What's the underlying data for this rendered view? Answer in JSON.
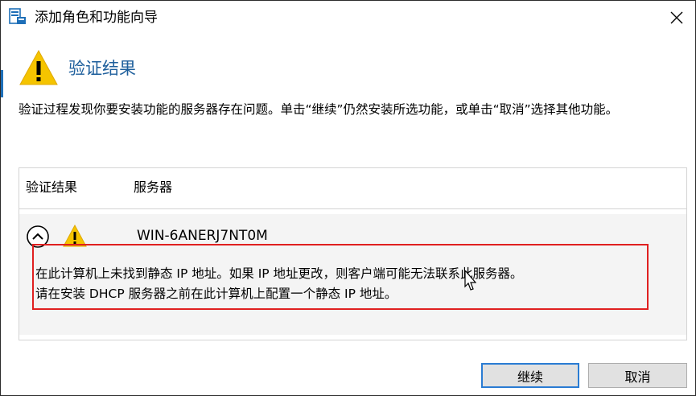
{
  "window": {
    "title": "添加角色和功能向导"
  },
  "dialog": {
    "heading": "验证结果",
    "description": "验证过程发现你要安装功能的服务器存在问题。单击“继续”仍然安装所选功能，或单击“取消”选择其他功能。"
  },
  "table": {
    "columns": [
      "验证结果",
      "服务器"
    ],
    "rows": [
      {
        "server": "WIN-6ANERJ7NT0M",
        "detail_line1": "在此计算机上未找到静态 IP 地址。如果 IP 地址更改，则客户端可能无法联系此服务器。",
        "detail_line2": "请在安装 DHCP 服务器之前在此计算机上配置一个静态 IP 地址。"
      }
    ]
  },
  "buttons": {
    "continue": "继续",
    "cancel": "取消"
  },
  "colors": {
    "heading": "#1e5f9c",
    "warning": "#f5c400",
    "highlight": "#e02020",
    "focus": "#2a7cd3"
  }
}
